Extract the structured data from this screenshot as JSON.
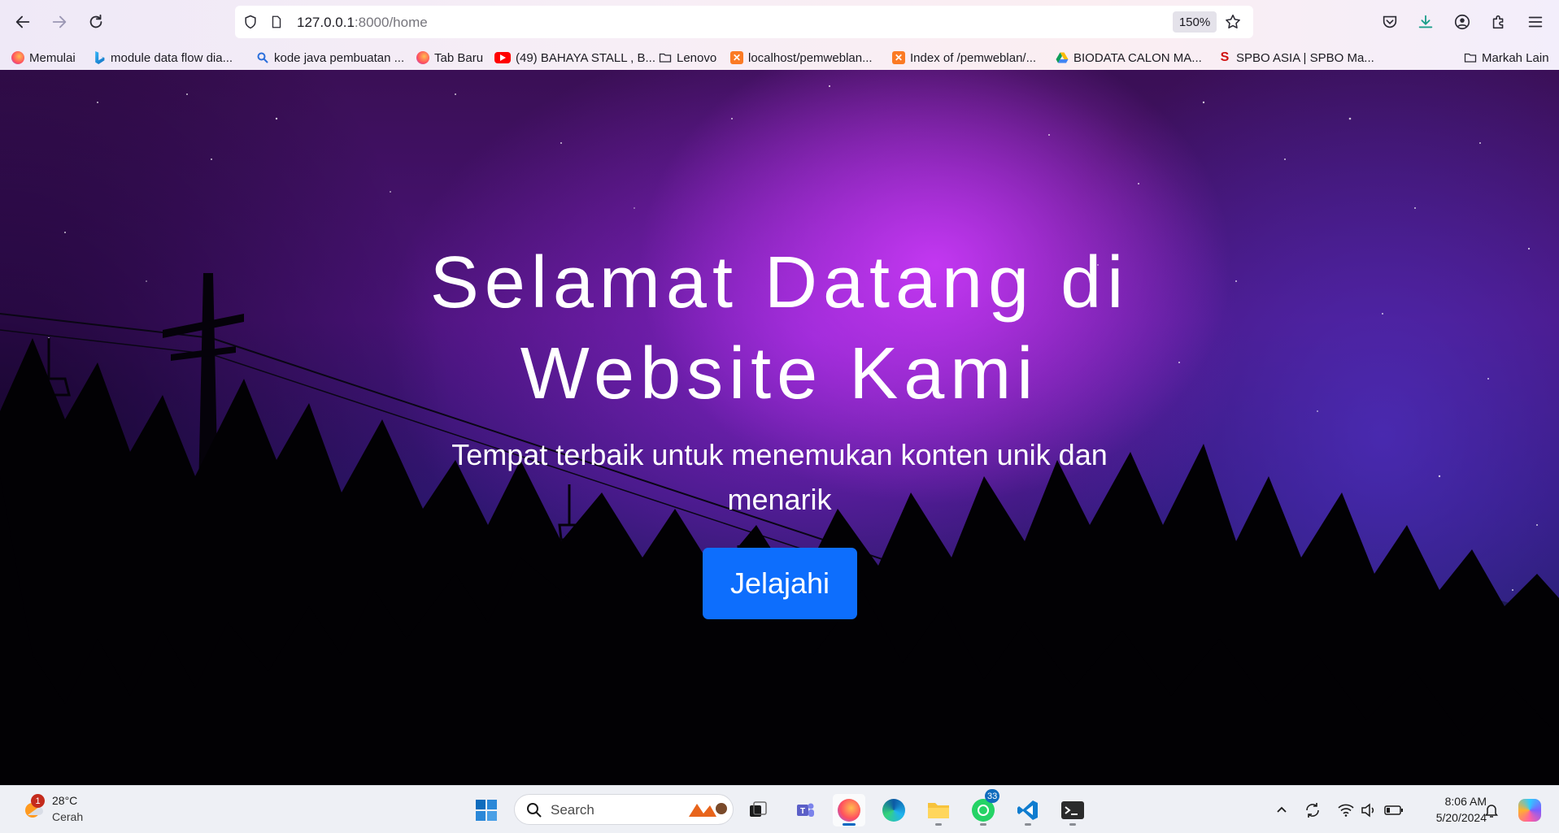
{
  "browser": {
    "url_host": "127.0.0.1",
    "url_path": ":8000/home",
    "zoom": "150%",
    "bookmarks": [
      {
        "label": "Memulai",
        "icon": "firefox-icon"
      },
      {
        "label": "module data flow dia...",
        "icon": "bing-icon"
      },
      {
        "label": "kode java pembuatan ...",
        "icon": "search-icon"
      },
      {
        "label": "Tab Baru",
        "icon": "firefox-icon"
      },
      {
        "label": "(49) BAHAYA STALL , B...",
        "icon": "youtube-icon"
      },
      {
        "label": "Lenovo",
        "icon": "folder-icon"
      },
      {
        "label": "localhost/pemweblan...",
        "icon": "xampp-icon"
      },
      {
        "label": "Index of /pemweblan/...",
        "icon": "xampp-icon"
      },
      {
        "label": "BIODATA CALON MA...",
        "icon": "google-drive-icon"
      },
      {
        "label": "SPBO ASIA | SPBO Ma...",
        "icon": "spbo-icon"
      }
    ],
    "other_bookmarks": "Markah Lain"
  },
  "hero": {
    "title_line1": "Selamat Datang di",
    "title_line2": "Website Kami",
    "subtitle_line1": "Tempat terbaik untuk menemukan konten unik dan",
    "subtitle_line2": "menarik",
    "button_label": "Jelajahi"
  },
  "taskbar": {
    "weather_temp": "28°C",
    "weather_desc": "Cerah",
    "weather_badge": "1",
    "search_placeholder": "Search",
    "whatsapp_badge": "33",
    "time": "8:06 AM",
    "date": "5/20/2024"
  },
  "colors": {
    "button": "#0d6efd",
    "hero_glow": "#d23cff"
  }
}
